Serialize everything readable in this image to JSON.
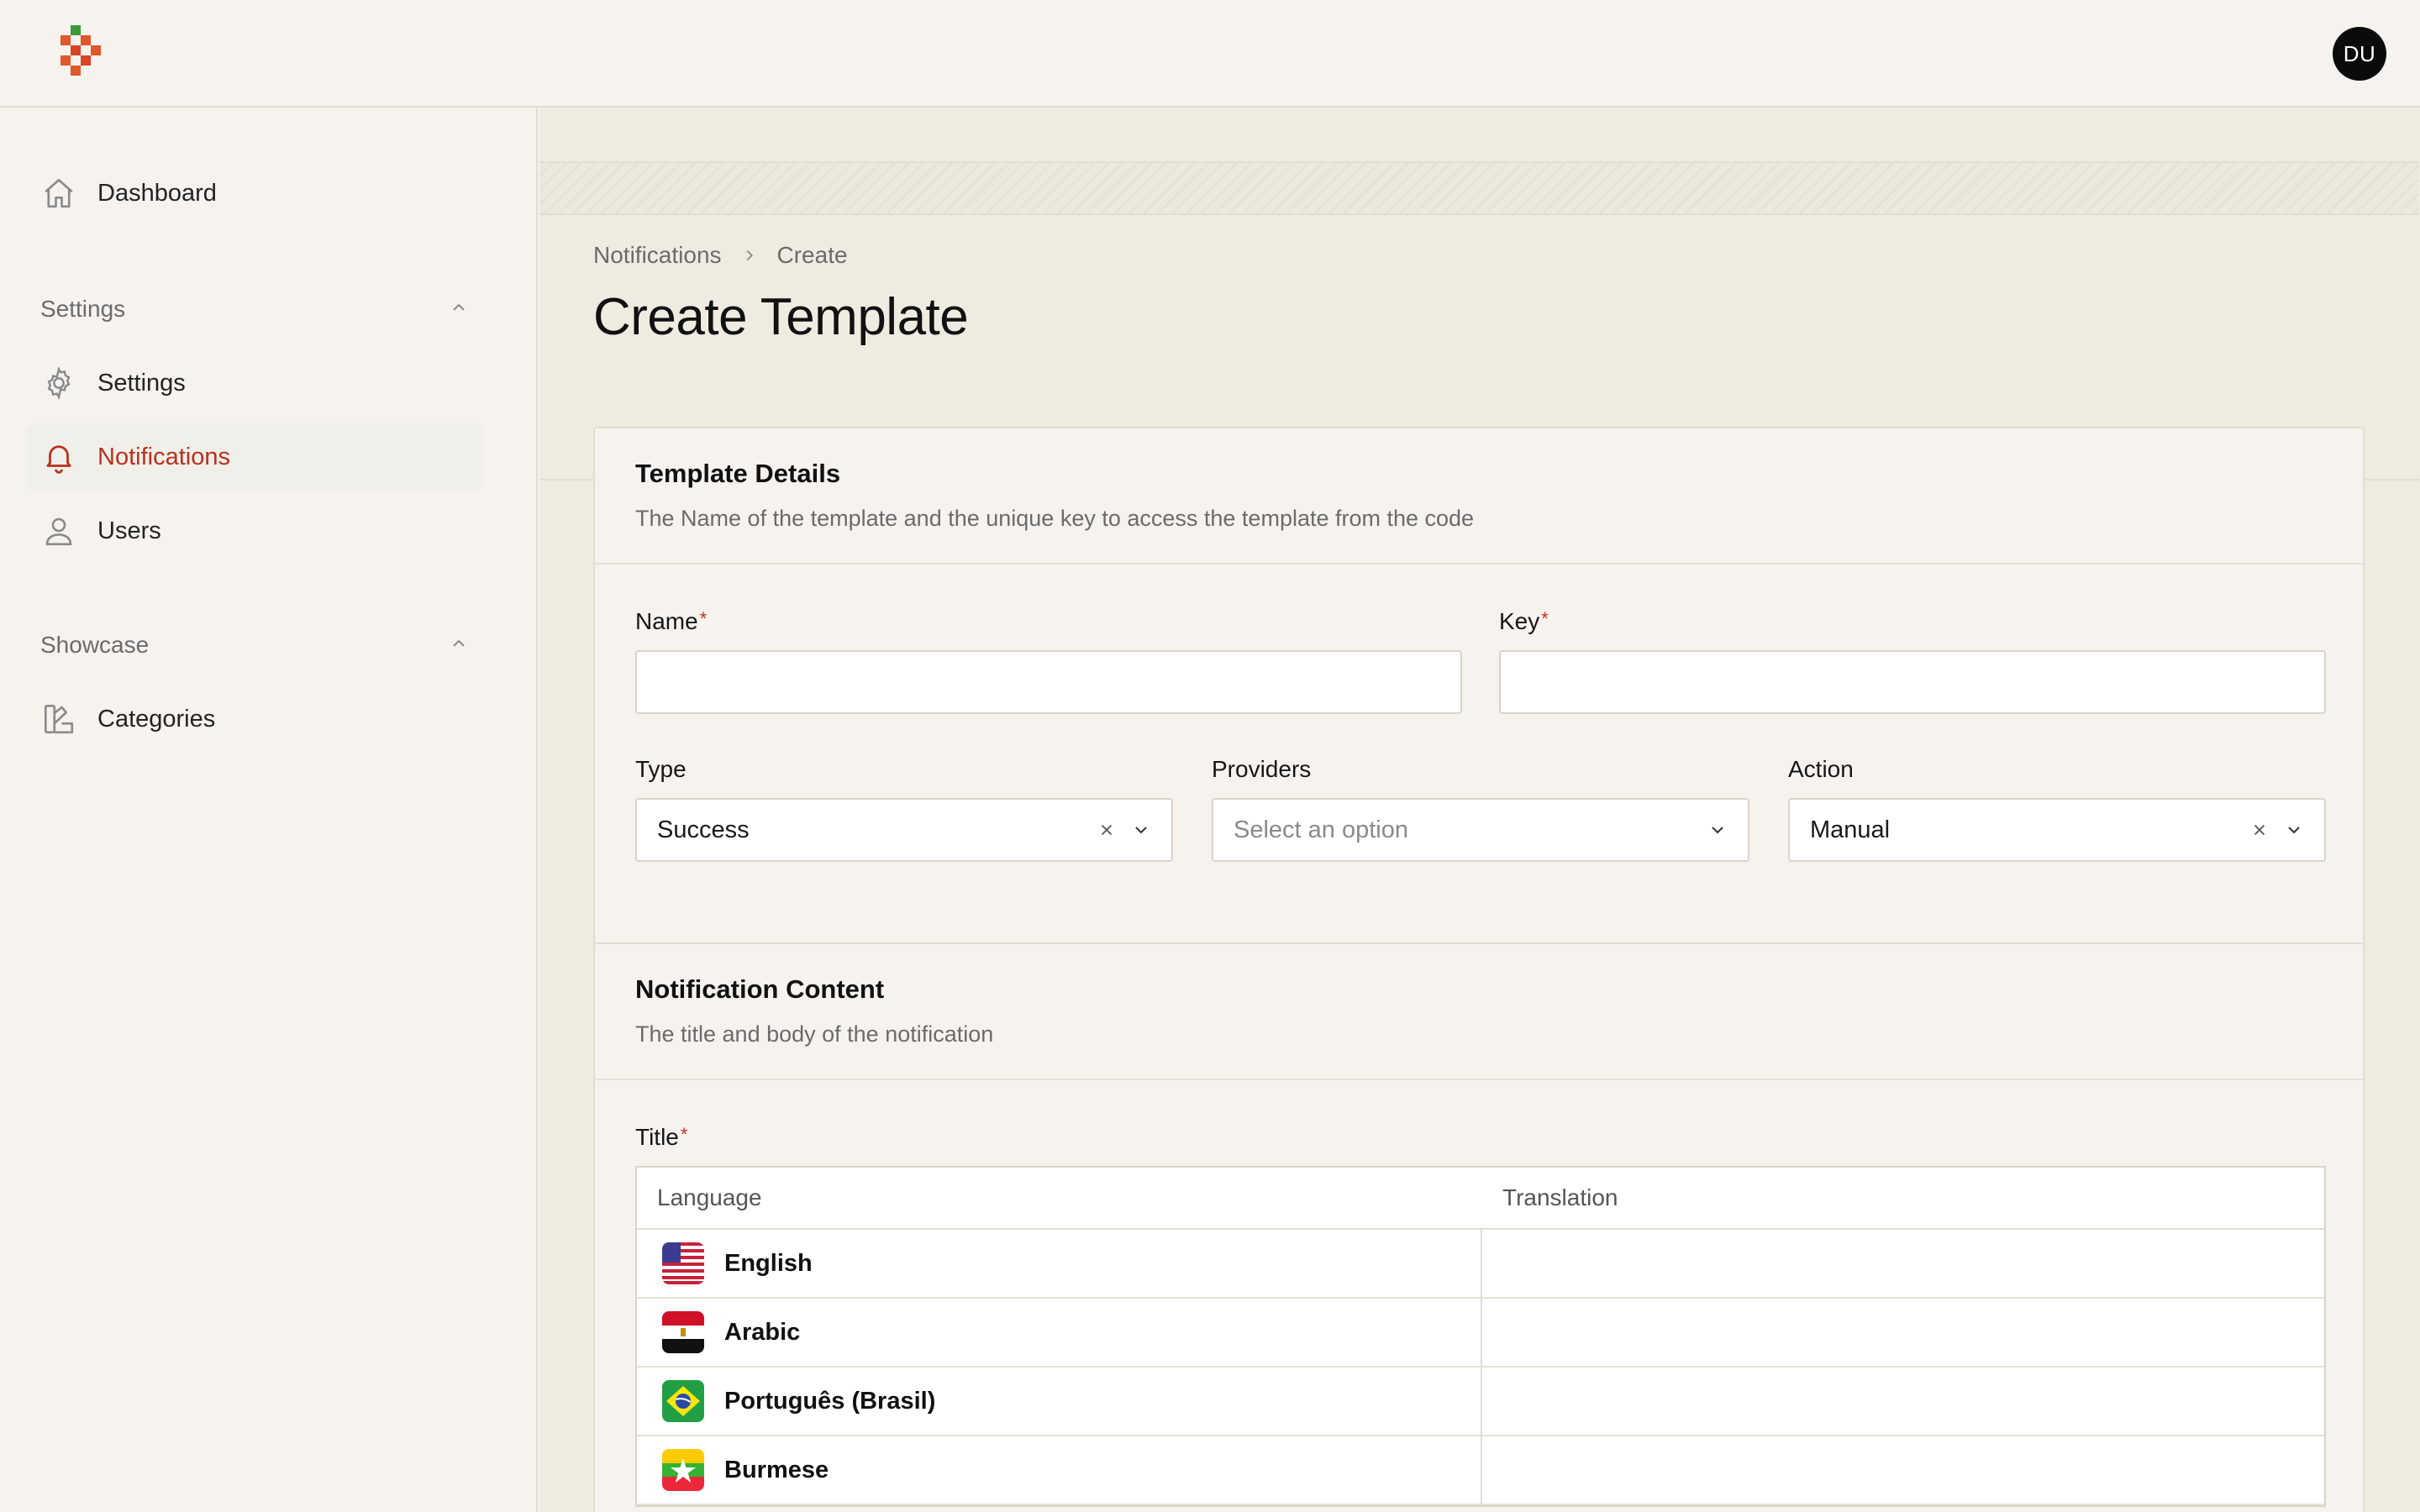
{
  "app": {
    "avatar_initials": "DU",
    "accent_color": "#b8321d"
  },
  "sidebar": {
    "dashboard": {
      "label": "Dashboard",
      "icon": "home-icon"
    },
    "groups": [
      {
        "label": "Settings",
        "items": [
          {
            "label": "Settings",
            "icon": "gear-icon"
          },
          {
            "label": "Notifications",
            "icon": "bell-icon",
            "active": true
          },
          {
            "label": "Users",
            "icon": "user-icon"
          }
        ]
      },
      {
        "label": "Showcase",
        "items": [
          {
            "label": "Categories",
            "icon": "swatch-icon"
          }
        ]
      }
    ]
  },
  "breadcrumb": {
    "parent": "Notifications",
    "current": "Create"
  },
  "page": {
    "title": "Create Template"
  },
  "template_details": {
    "title": "Template Details",
    "description": "The Name of the template and the unique key to access the template from the code",
    "name": {
      "label": "Name",
      "required_mark": "*",
      "value": ""
    },
    "key": {
      "label": "Key",
      "required_mark": "*",
      "value": ""
    },
    "type": {
      "label": "Type",
      "value": "Success"
    },
    "providers": {
      "label": "Providers",
      "placeholder": "Select an option"
    },
    "action": {
      "label": "Action",
      "value": "Manual"
    }
  },
  "notification_content": {
    "title": "Notification Content",
    "description": "The title and body of the notification",
    "title_field": {
      "label": "Title",
      "required_mark": "*"
    },
    "table": {
      "headers": {
        "language": "Language",
        "translation": "Translation"
      },
      "rows": [
        {
          "language": "English",
          "flag": "us-flag-icon",
          "translation": ""
        },
        {
          "language": "Arabic",
          "flag": "egypt-flag-icon",
          "translation": ""
        },
        {
          "language": "Português (Brasil)",
          "flag": "brazil-flag-icon",
          "translation": ""
        },
        {
          "language": "Burmese",
          "flag": "myanmar-flag-icon",
          "translation": ""
        }
      ]
    }
  }
}
